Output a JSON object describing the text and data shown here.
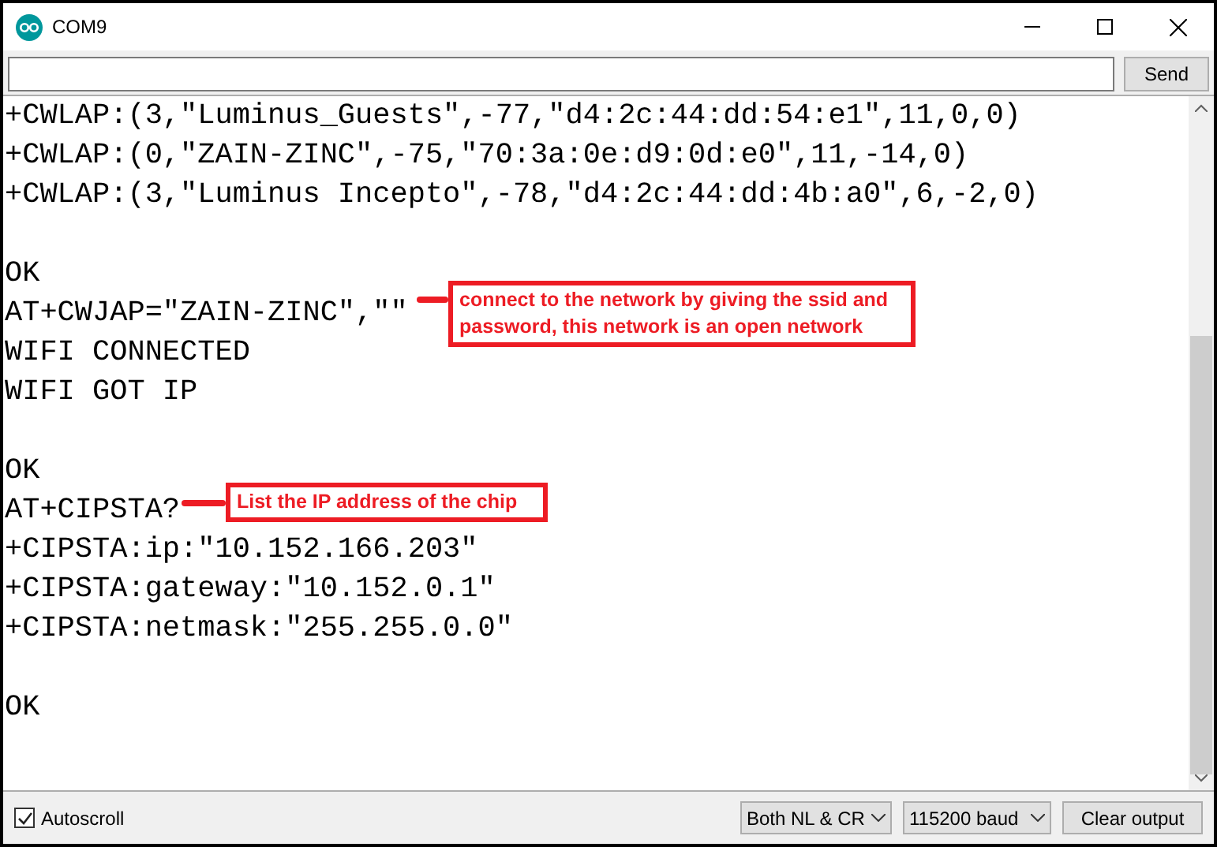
{
  "window": {
    "title": "COM9"
  },
  "send_button": "Send",
  "output": [
    {
      "lines": [
        "+CWLAP:(3,\"Luminus_Guests\",-77,\"d4:2c:44:dd:54:e1\",11,0,0)",
        "+CWLAP:(0,\"ZAIN-ZINC\",-75,\"70:3a:0e:d9:0d:e0\",11,-14,0)",
        "+CWLAP:(3,\"Luminus Incepto\",-78,\"d4:2c:44:dd:4b:a0\",6,-2,0)"
      ]
    },
    {
      "lines": [
        "OK",
        "AT+CWJAP=\"ZAIN-ZINC\",\"\"",
        "WIFI CONNECTED",
        "WIFI GOT IP"
      ]
    },
    {
      "lines": [
        "OK",
        "AT+CIPSTA?",
        "+CIPSTA:ip:\"10.152.166.203\"",
        "+CIPSTA:gateway:\"10.152.0.1\"",
        "+CIPSTA:netmask:\"255.255.0.0\""
      ]
    },
    {
      "lines": [
        "OK"
      ]
    }
  ],
  "annotations": [
    {
      "text": "connect to the network by giving the ssid and password, this network is an open network"
    },
    {
      "text": "List the IP address of the chip"
    }
  ],
  "status_bar": {
    "autoscroll": {
      "label": "Autoscroll",
      "checked": true
    },
    "line_ending": "Both NL & CR",
    "baud": "115200 baud",
    "clear_button": "Clear output"
  }
}
